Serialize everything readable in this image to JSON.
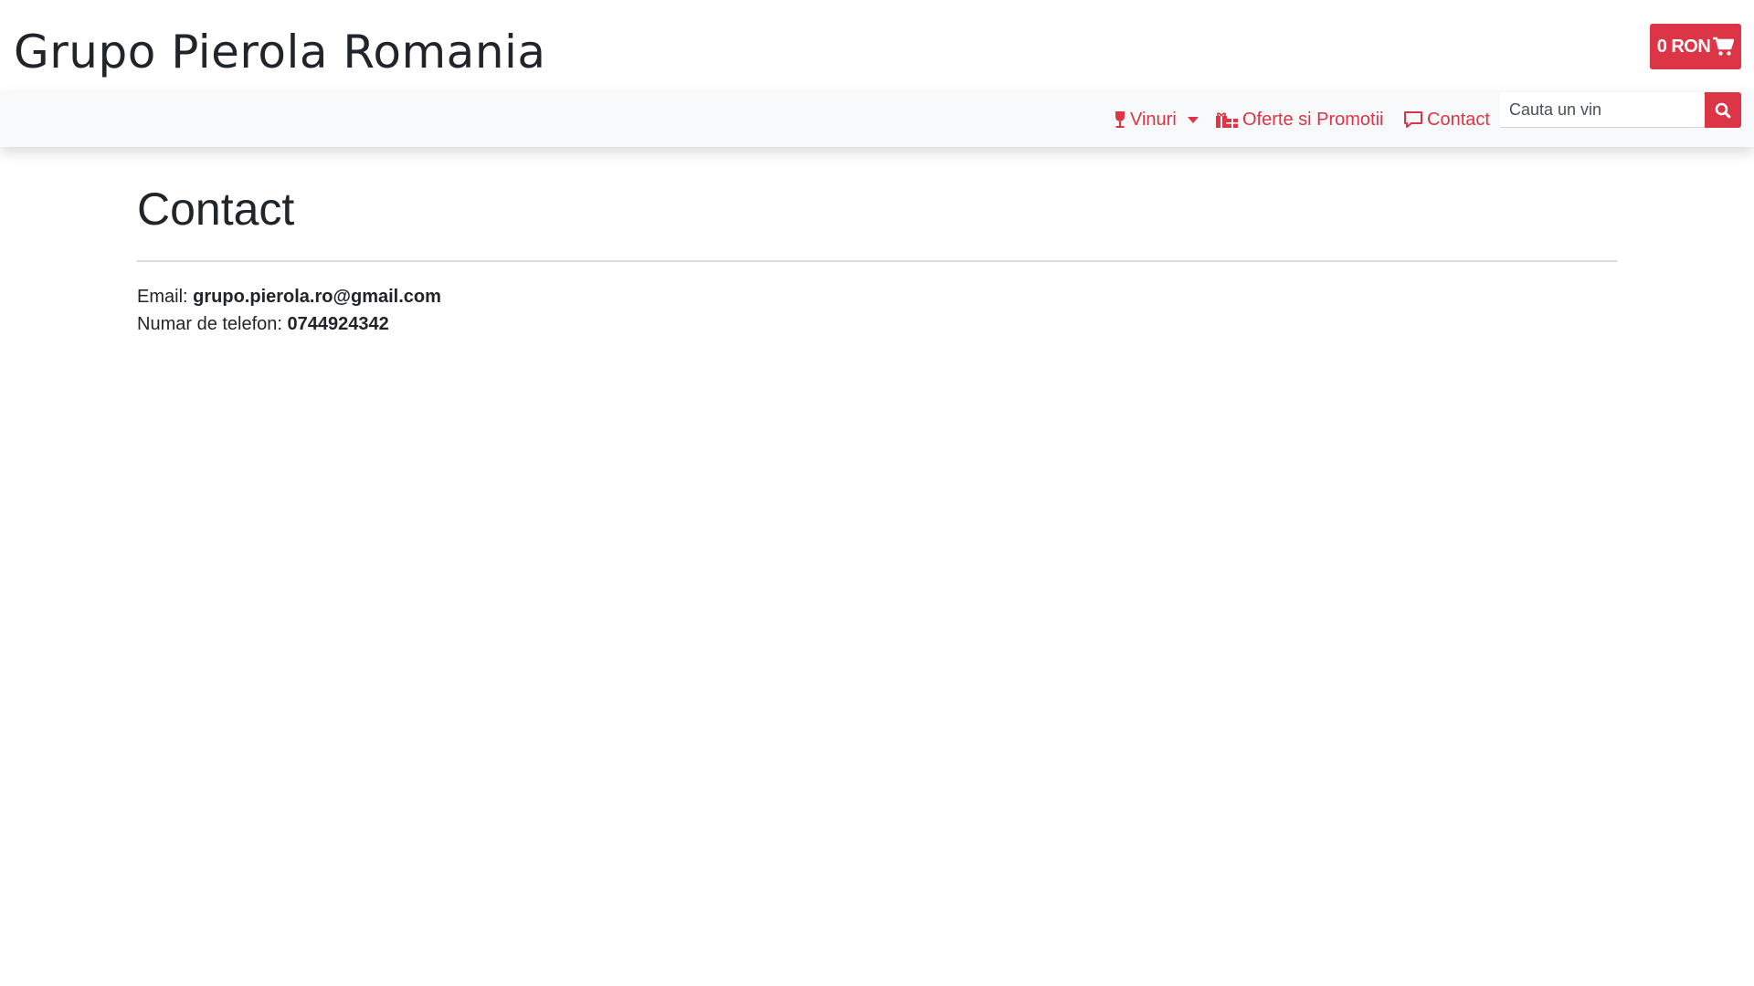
{
  "header": {
    "brand": "Grupo Pierola Romania",
    "cart_total": "0 RON"
  },
  "nav": {
    "items": [
      {
        "label": "Vinuri",
        "icon": "wine-glass-icon",
        "has_dropdown": true
      },
      {
        "label": "Oferte si Promotii",
        "icon": "gifts-icon",
        "has_dropdown": false
      },
      {
        "label": "Contact",
        "icon": "comment-icon",
        "has_dropdown": false
      }
    ],
    "search": {
      "placeholder": "Cauta un vin",
      "value": "",
      "button_icon": "search-icon"
    }
  },
  "main": {
    "title": "Contact",
    "email_label": "Email:",
    "email_value": "grupo.pierola.ro@gmail.com",
    "phone_label": "Numar de telefon:",
    "phone_value": "0744924342"
  },
  "colors": {
    "accent": "#dc3545",
    "navbar_bg": "#f8f9fa",
    "text": "#212529"
  }
}
